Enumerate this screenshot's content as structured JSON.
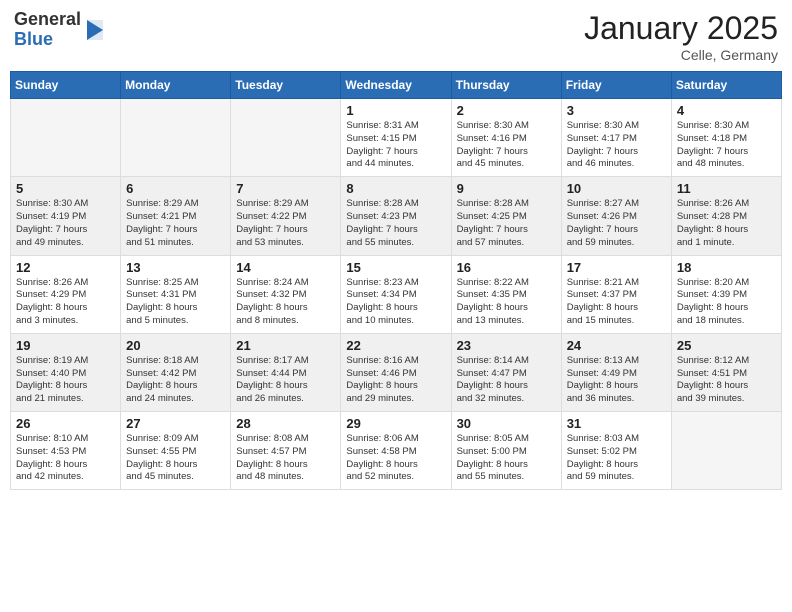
{
  "header": {
    "logo_general": "General",
    "logo_blue": "Blue",
    "month_title": "January 2025",
    "location": "Celle, Germany"
  },
  "days_of_week": [
    "Sunday",
    "Monday",
    "Tuesday",
    "Wednesday",
    "Thursday",
    "Friday",
    "Saturday"
  ],
  "weeks": [
    {
      "shaded": false,
      "days": [
        {
          "num": "",
          "info": ""
        },
        {
          "num": "",
          "info": ""
        },
        {
          "num": "",
          "info": ""
        },
        {
          "num": "1",
          "info": "Sunrise: 8:31 AM\nSunset: 4:15 PM\nDaylight: 7 hours\nand 44 minutes."
        },
        {
          "num": "2",
          "info": "Sunrise: 8:30 AM\nSunset: 4:16 PM\nDaylight: 7 hours\nand 45 minutes."
        },
        {
          "num": "3",
          "info": "Sunrise: 8:30 AM\nSunset: 4:17 PM\nDaylight: 7 hours\nand 46 minutes."
        },
        {
          "num": "4",
          "info": "Sunrise: 8:30 AM\nSunset: 4:18 PM\nDaylight: 7 hours\nand 48 minutes."
        }
      ]
    },
    {
      "shaded": true,
      "days": [
        {
          "num": "5",
          "info": "Sunrise: 8:30 AM\nSunset: 4:19 PM\nDaylight: 7 hours\nand 49 minutes."
        },
        {
          "num": "6",
          "info": "Sunrise: 8:29 AM\nSunset: 4:21 PM\nDaylight: 7 hours\nand 51 minutes."
        },
        {
          "num": "7",
          "info": "Sunrise: 8:29 AM\nSunset: 4:22 PM\nDaylight: 7 hours\nand 53 minutes."
        },
        {
          "num": "8",
          "info": "Sunrise: 8:28 AM\nSunset: 4:23 PM\nDaylight: 7 hours\nand 55 minutes."
        },
        {
          "num": "9",
          "info": "Sunrise: 8:28 AM\nSunset: 4:25 PM\nDaylight: 7 hours\nand 57 minutes."
        },
        {
          "num": "10",
          "info": "Sunrise: 8:27 AM\nSunset: 4:26 PM\nDaylight: 7 hours\nand 59 minutes."
        },
        {
          "num": "11",
          "info": "Sunrise: 8:26 AM\nSunset: 4:28 PM\nDaylight: 8 hours\nand 1 minute."
        }
      ]
    },
    {
      "shaded": false,
      "days": [
        {
          "num": "12",
          "info": "Sunrise: 8:26 AM\nSunset: 4:29 PM\nDaylight: 8 hours\nand 3 minutes."
        },
        {
          "num": "13",
          "info": "Sunrise: 8:25 AM\nSunset: 4:31 PM\nDaylight: 8 hours\nand 5 minutes."
        },
        {
          "num": "14",
          "info": "Sunrise: 8:24 AM\nSunset: 4:32 PM\nDaylight: 8 hours\nand 8 minutes."
        },
        {
          "num": "15",
          "info": "Sunrise: 8:23 AM\nSunset: 4:34 PM\nDaylight: 8 hours\nand 10 minutes."
        },
        {
          "num": "16",
          "info": "Sunrise: 8:22 AM\nSunset: 4:35 PM\nDaylight: 8 hours\nand 13 minutes."
        },
        {
          "num": "17",
          "info": "Sunrise: 8:21 AM\nSunset: 4:37 PM\nDaylight: 8 hours\nand 15 minutes."
        },
        {
          "num": "18",
          "info": "Sunrise: 8:20 AM\nSunset: 4:39 PM\nDaylight: 8 hours\nand 18 minutes."
        }
      ]
    },
    {
      "shaded": true,
      "days": [
        {
          "num": "19",
          "info": "Sunrise: 8:19 AM\nSunset: 4:40 PM\nDaylight: 8 hours\nand 21 minutes."
        },
        {
          "num": "20",
          "info": "Sunrise: 8:18 AM\nSunset: 4:42 PM\nDaylight: 8 hours\nand 24 minutes."
        },
        {
          "num": "21",
          "info": "Sunrise: 8:17 AM\nSunset: 4:44 PM\nDaylight: 8 hours\nand 26 minutes."
        },
        {
          "num": "22",
          "info": "Sunrise: 8:16 AM\nSunset: 4:46 PM\nDaylight: 8 hours\nand 29 minutes."
        },
        {
          "num": "23",
          "info": "Sunrise: 8:14 AM\nSunset: 4:47 PM\nDaylight: 8 hours\nand 32 minutes."
        },
        {
          "num": "24",
          "info": "Sunrise: 8:13 AM\nSunset: 4:49 PM\nDaylight: 8 hours\nand 36 minutes."
        },
        {
          "num": "25",
          "info": "Sunrise: 8:12 AM\nSunset: 4:51 PM\nDaylight: 8 hours\nand 39 minutes."
        }
      ]
    },
    {
      "shaded": false,
      "days": [
        {
          "num": "26",
          "info": "Sunrise: 8:10 AM\nSunset: 4:53 PM\nDaylight: 8 hours\nand 42 minutes."
        },
        {
          "num": "27",
          "info": "Sunrise: 8:09 AM\nSunset: 4:55 PM\nDaylight: 8 hours\nand 45 minutes."
        },
        {
          "num": "28",
          "info": "Sunrise: 8:08 AM\nSunset: 4:57 PM\nDaylight: 8 hours\nand 48 minutes."
        },
        {
          "num": "29",
          "info": "Sunrise: 8:06 AM\nSunset: 4:58 PM\nDaylight: 8 hours\nand 52 minutes."
        },
        {
          "num": "30",
          "info": "Sunrise: 8:05 AM\nSunset: 5:00 PM\nDaylight: 8 hours\nand 55 minutes."
        },
        {
          "num": "31",
          "info": "Sunrise: 8:03 AM\nSunset: 5:02 PM\nDaylight: 8 hours\nand 59 minutes."
        },
        {
          "num": "",
          "info": ""
        }
      ]
    }
  ]
}
